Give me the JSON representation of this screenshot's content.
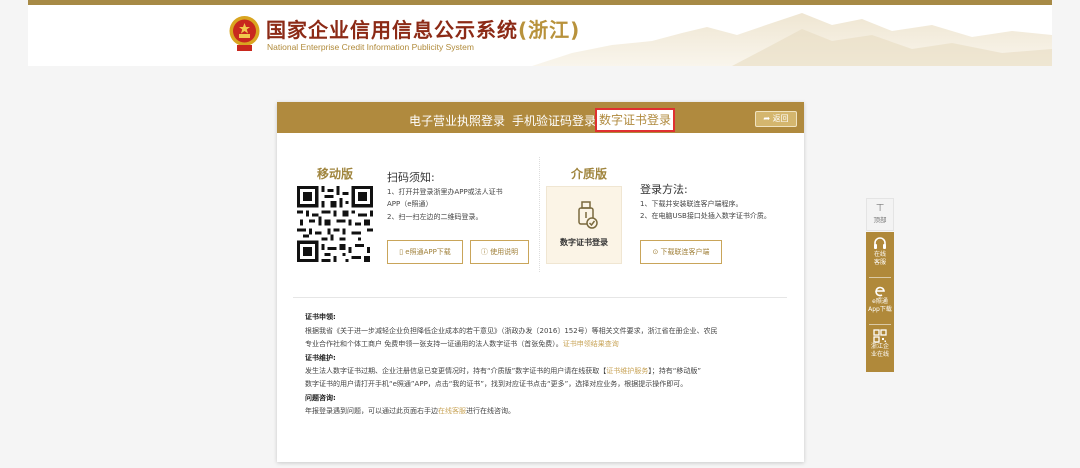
{
  "header": {
    "title": "国家企业信用信息公示系统",
    "province": "(浙江)",
    "subtitle": "National Enterprise Credit Information Publicity System"
  },
  "tabs": [
    {
      "label": "电子营业执照登录"
    },
    {
      "label": "手机验证码登录"
    },
    {
      "label": "数字证书登录",
      "active": true
    }
  ],
  "back_label": "返回",
  "mobile": {
    "title": "移动版",
    "notice_title": "扫码须知:",
    "notice_lines": [
      "1、打开并登录浙里办APP或法人证书",
      "APP（e照通）",
      "2、扫一扫左边的二维码登录。"
    ],
    "app_button": "e照通APP下载",
    "guide_button": "使用说明"
  },
  "medium": {
    "title": "介质版",
    "box_label": "数字证书登录",
    "login_title": "登录方法:",
    "login_lines": [
      "1、下载并安装联连客户端程序。",
      "2、在电脑USB接口处插入数字证书介质。"
    ],
    "download_button": "下载联连客户端"
  },
  "info": {
    "apply_head": "证书申领:",
    "apply_line1": "根据我省《关于进一步减轻企业负担降低企业成本的若干意见》（浙政办发〔2016〕152号）等相关文件要求，浙江省在册企业、农民",
    "apply_line2_text": "专业合作社和个体工商户 免费申领一张支持一证通用的法人数字证书（首张免费）。",
    "apply_line2_link": "证书申领结果查询",
    "maint_head": "证书维护:",
    "maint_line1_a": "发生法人数字证书过期、企业注册信息已变更情况时，持有“介质版”数字证书的用户请在线获取【",
    "maint_line1_link": "证书维护服务",
    "maint_line1_b": "】；持有“移动版”",
    "maint_line2": "数字证书的用户请打开手机“e照通”APP，点击“我的证书”，找到对应证书点击“更多”，选择对应业务，根据提示操作即可。",
    "faq_head": "问题咨询:",
    "faq_line_a": "年报登录遇到问题，可以通过此页面右手边",
    "faq_line_link": "在线客服",
    "faq_line_b": "进行在线咨询。"
  },
  "float": {
    "top_label": "顶部",
    "items": [
      {
        "label1": "在线",
        "label2": "客服",
        "icon": "headset-icon"
      },
      {
        "label1": "e照通",
        "label2": "App下载",
        "icon": "e-icon"
      },
      {
        "label1": "浙江企",
        "label2": "业在线",
        "icon": "qr-icon"
      }
    ]
  },
  "colors": {
    "gold": "#b08a3e",
    "title_red": "#8c2a16",
    "active_border": "#e03030"
  }
}
